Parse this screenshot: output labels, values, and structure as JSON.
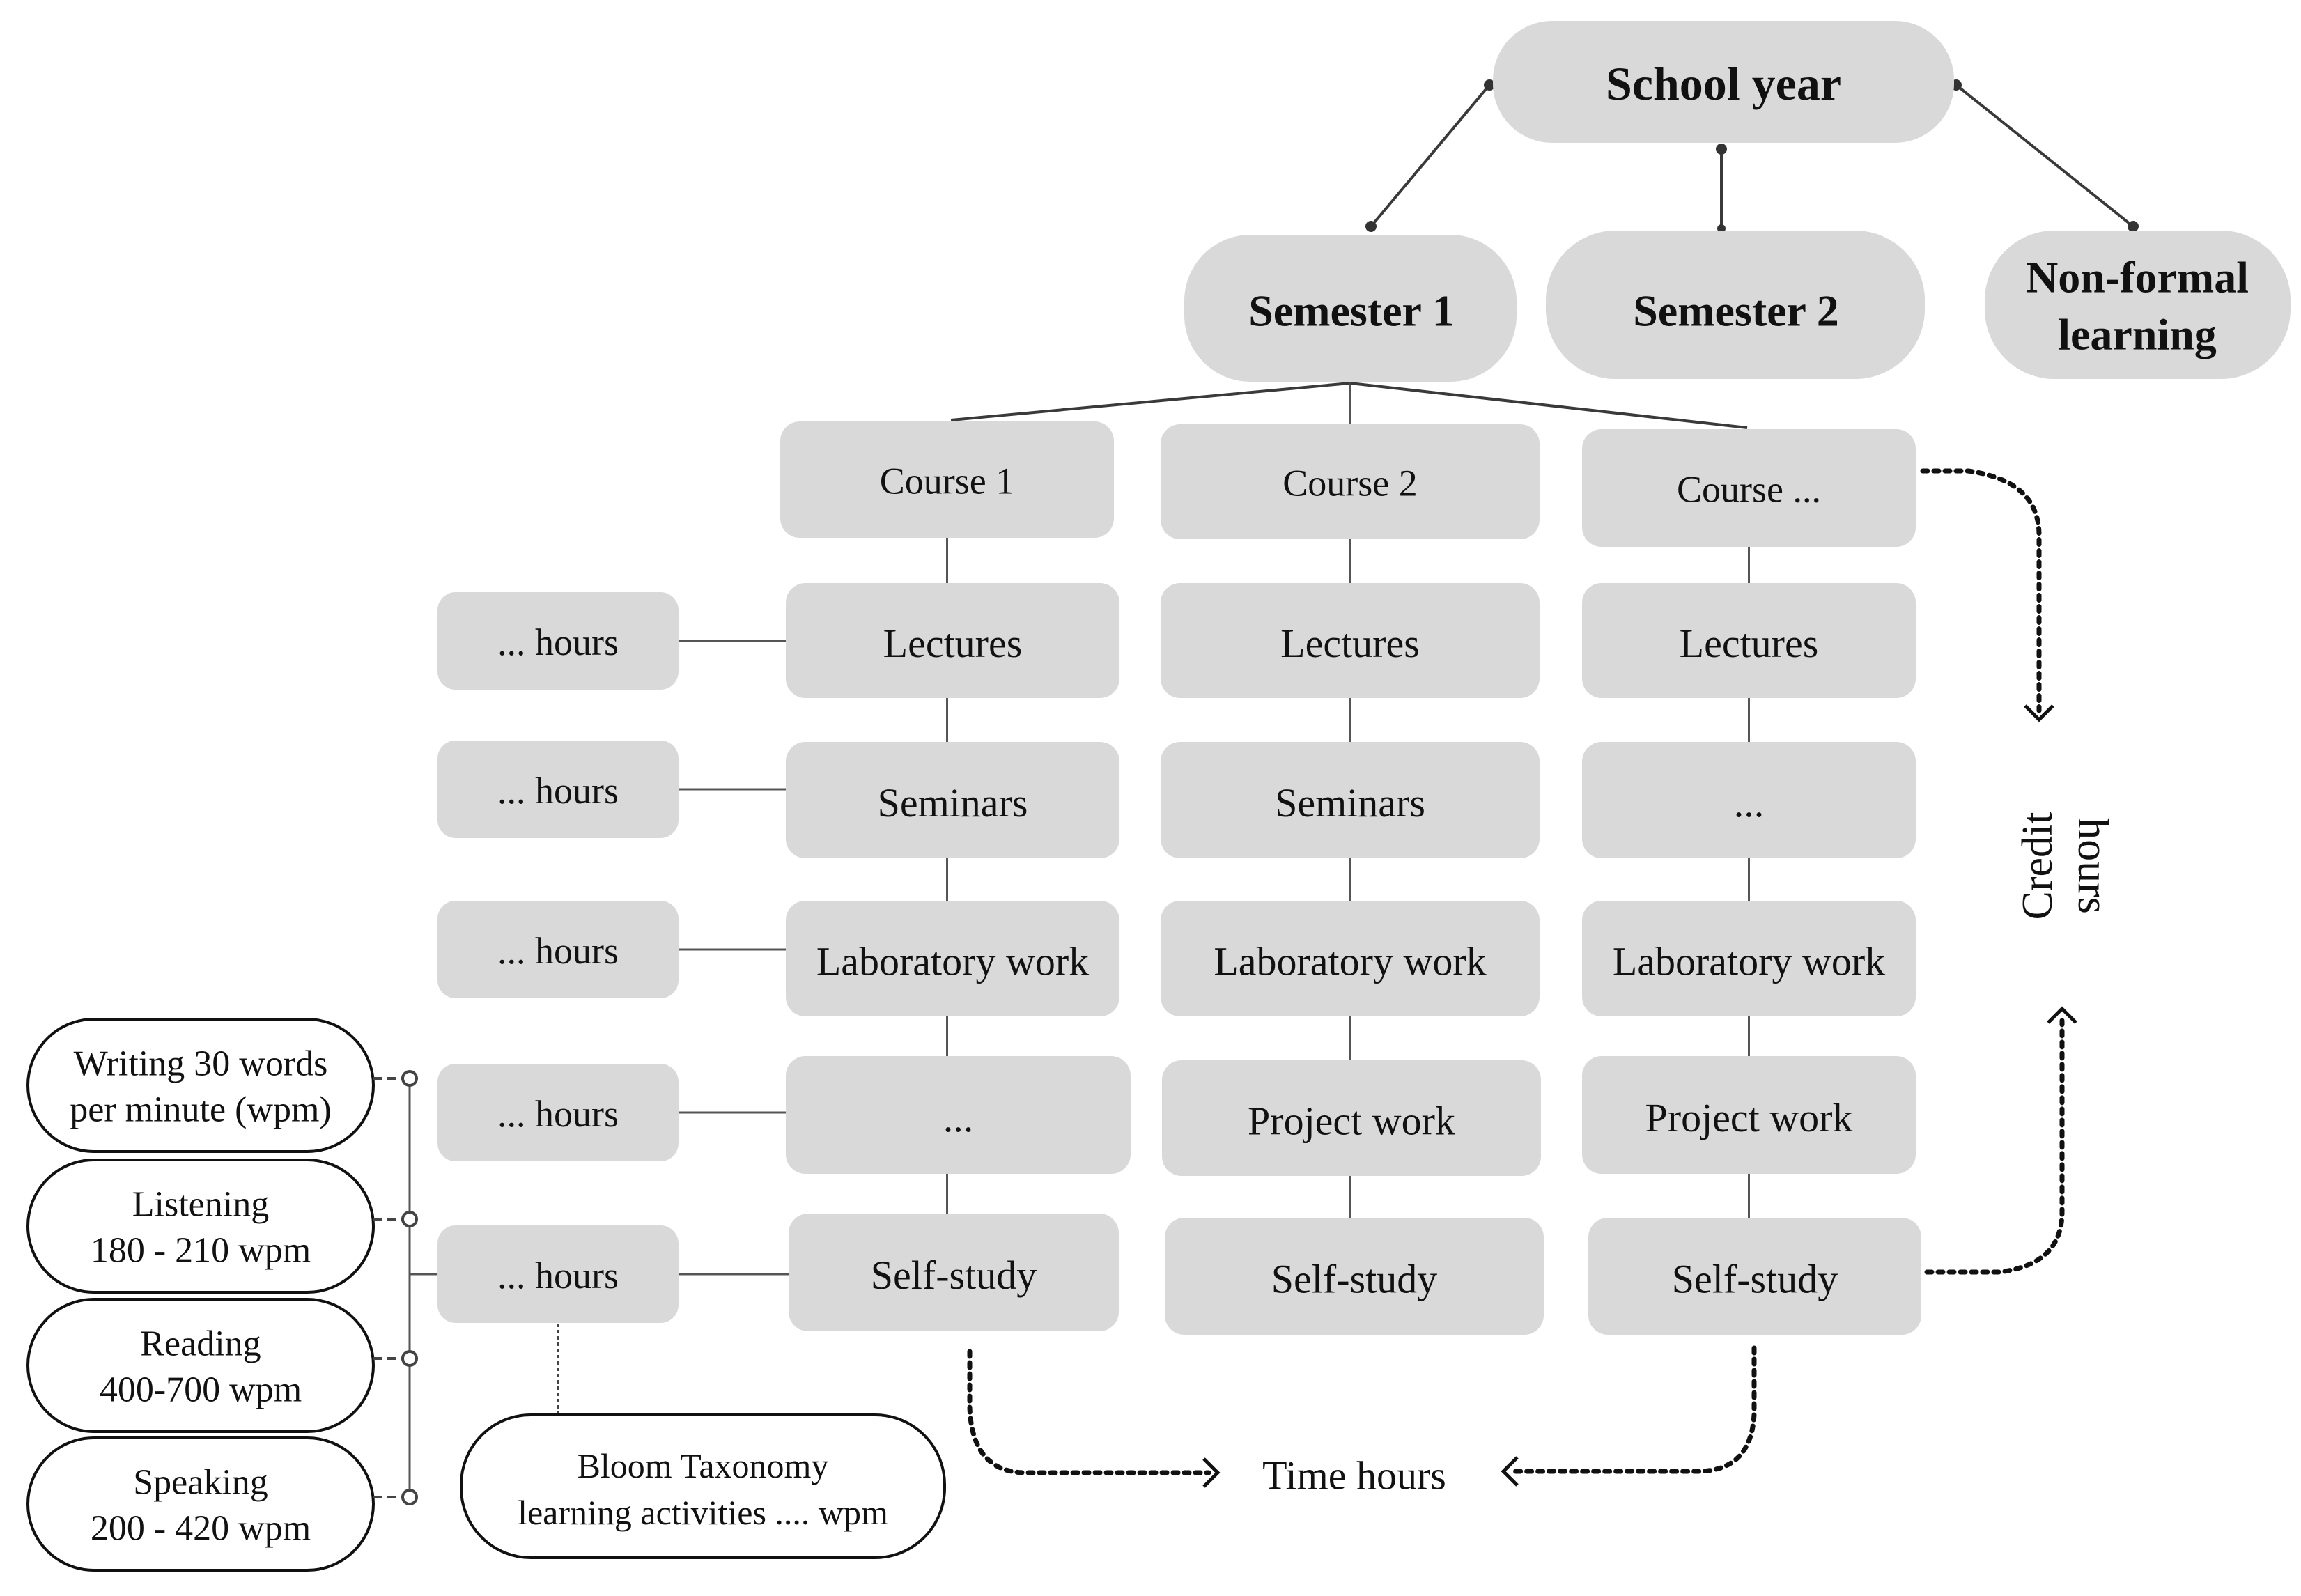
{
  "top": {
    "school_year": "School year",
    "semesters": [
      "Semester 1",
      "Semester 2"
    ],
    "non_formal": [
      "Non-formal",
      "learning"
    ]
  },
  "courses": [
    {
      "title": "Course 1",
      "activities": [
        "Lectures",
        "Seminars",
        "Laboratory work",
        "...",
        "Self-study"
      ]
    },
    {
      "title": "Course 2",
      "activities": [
        "Lectures",
        "Seminars",
        "Laboratory work",
        "Project work",
        "Self-study"
      ]
    },
    {
      "title": "Course ...",
      "activities": [
        "Lectures",
        "...",
        "Laboratory work",
        "Project work",
        "Self-study"
      ]
    }
  ],
  "hours_boxes": [
    "... hours",
    "... hours",
    "... hours",
    "... hours",
    "... hours"
  ],
  "skills": [
    {
      "line1": "Writing 30 words",
      "line2": "per minute (wpm)"
    },
    {
      "line1": "Listening",
      "line2": "180 - 210 wpm"
    },
    {
      "line1": "Reading",
      "line2": "400-700 wpm"
    },
    {
      "line1": "Speaking",
      "line2": "200 - 420 wpm"
    }
  ],
  "bloom": {
    "line1": "Bloom Taxonomy",
    "line2": "learning activities .... wpm"
  },
  "time_hours": "Time hours",
  "credit_hours": [
    "Credit",
    "hours"
  ]
}
